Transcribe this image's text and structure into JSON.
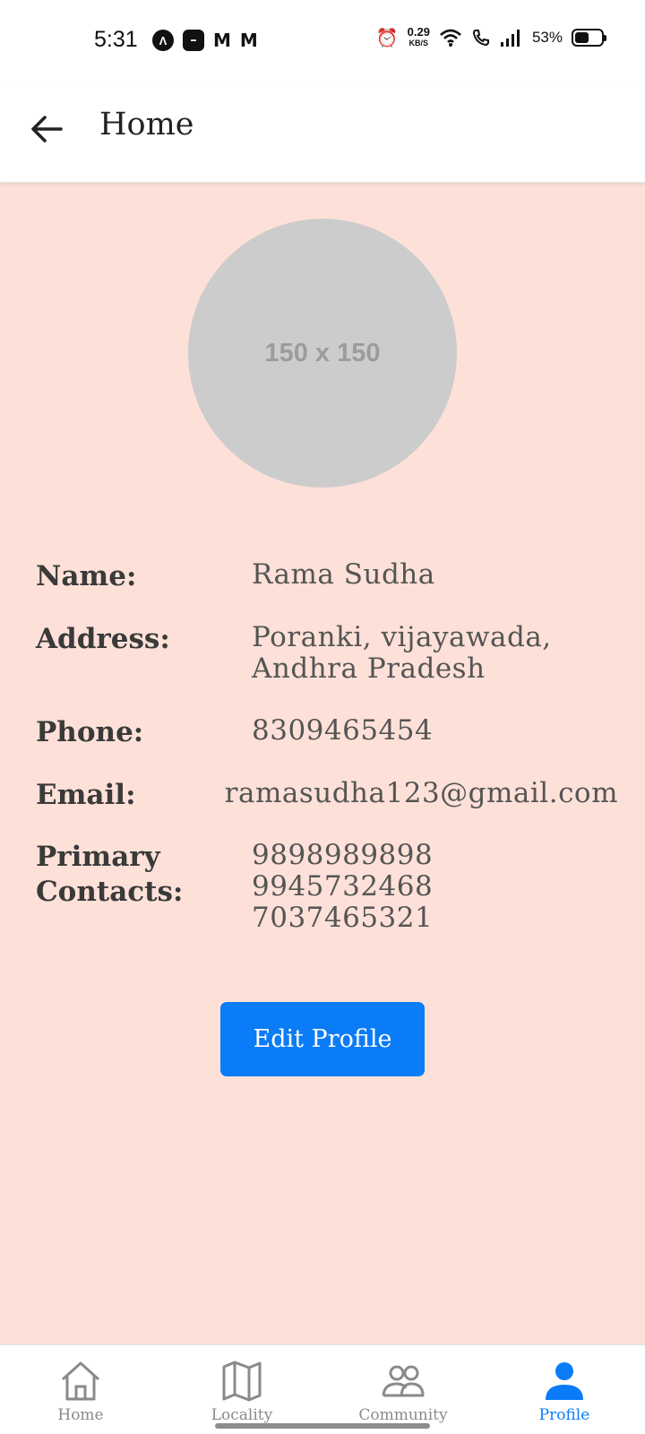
{
  "status_bar": {
    "time": "5:31",
    "net_speed_value": "0.29",
    "net_speed_unit": "KB/S",
    "battery_percent": "53%",
    "battery_level": 0.53
  },
  "app_bar": {
    "title": "Home",
    "back_icon": "arrow-left-icon"
  },
  "profile": {
    "avatar_placeholder": "150 x 150",
    "fields": {
      "name_label": "Name:",
      "name_value": "Rama Sudha",
      "address_label": "Address:",
      "address_value_line1": "Poranki, vijayawada,",
      "address_value_line2": "Andhra Pradesh",
      "phone_label": "Phone:",
      "phone_value": "8309465454",
      "email_label": "Email:",
      "email_value": "ramasudha123@gmail.com",
      "contacts_label_line1": "Primary",
      "contacts_label_line2": "Contacts:",
      "contacts": [
        "9898989898",
        "9945732468",
        "7037465321"
      ]
    },
    "edit_button_label": "Edit Profile"
  },
  "bottom_nav": {
    "items": [
      {
        "label": "Home",
        "icon": "home-icon",
        "active": false
      },
      {
        "label": "Locality",
        "icon": "map-icon",
        "active": false
      },
      {
        "label": "Community",
        "icon": "people-icon",
        "active": false
      },
      {
        "label": "Profile",
        "icon": "person-icon",
        "active": true
      }
    ]
  },
  "colors": {
    "content_background": "#fde1d8",
    "accent": "#0a7cf7",
    "avatar_placeholder": "#cccccc"
  }
}
